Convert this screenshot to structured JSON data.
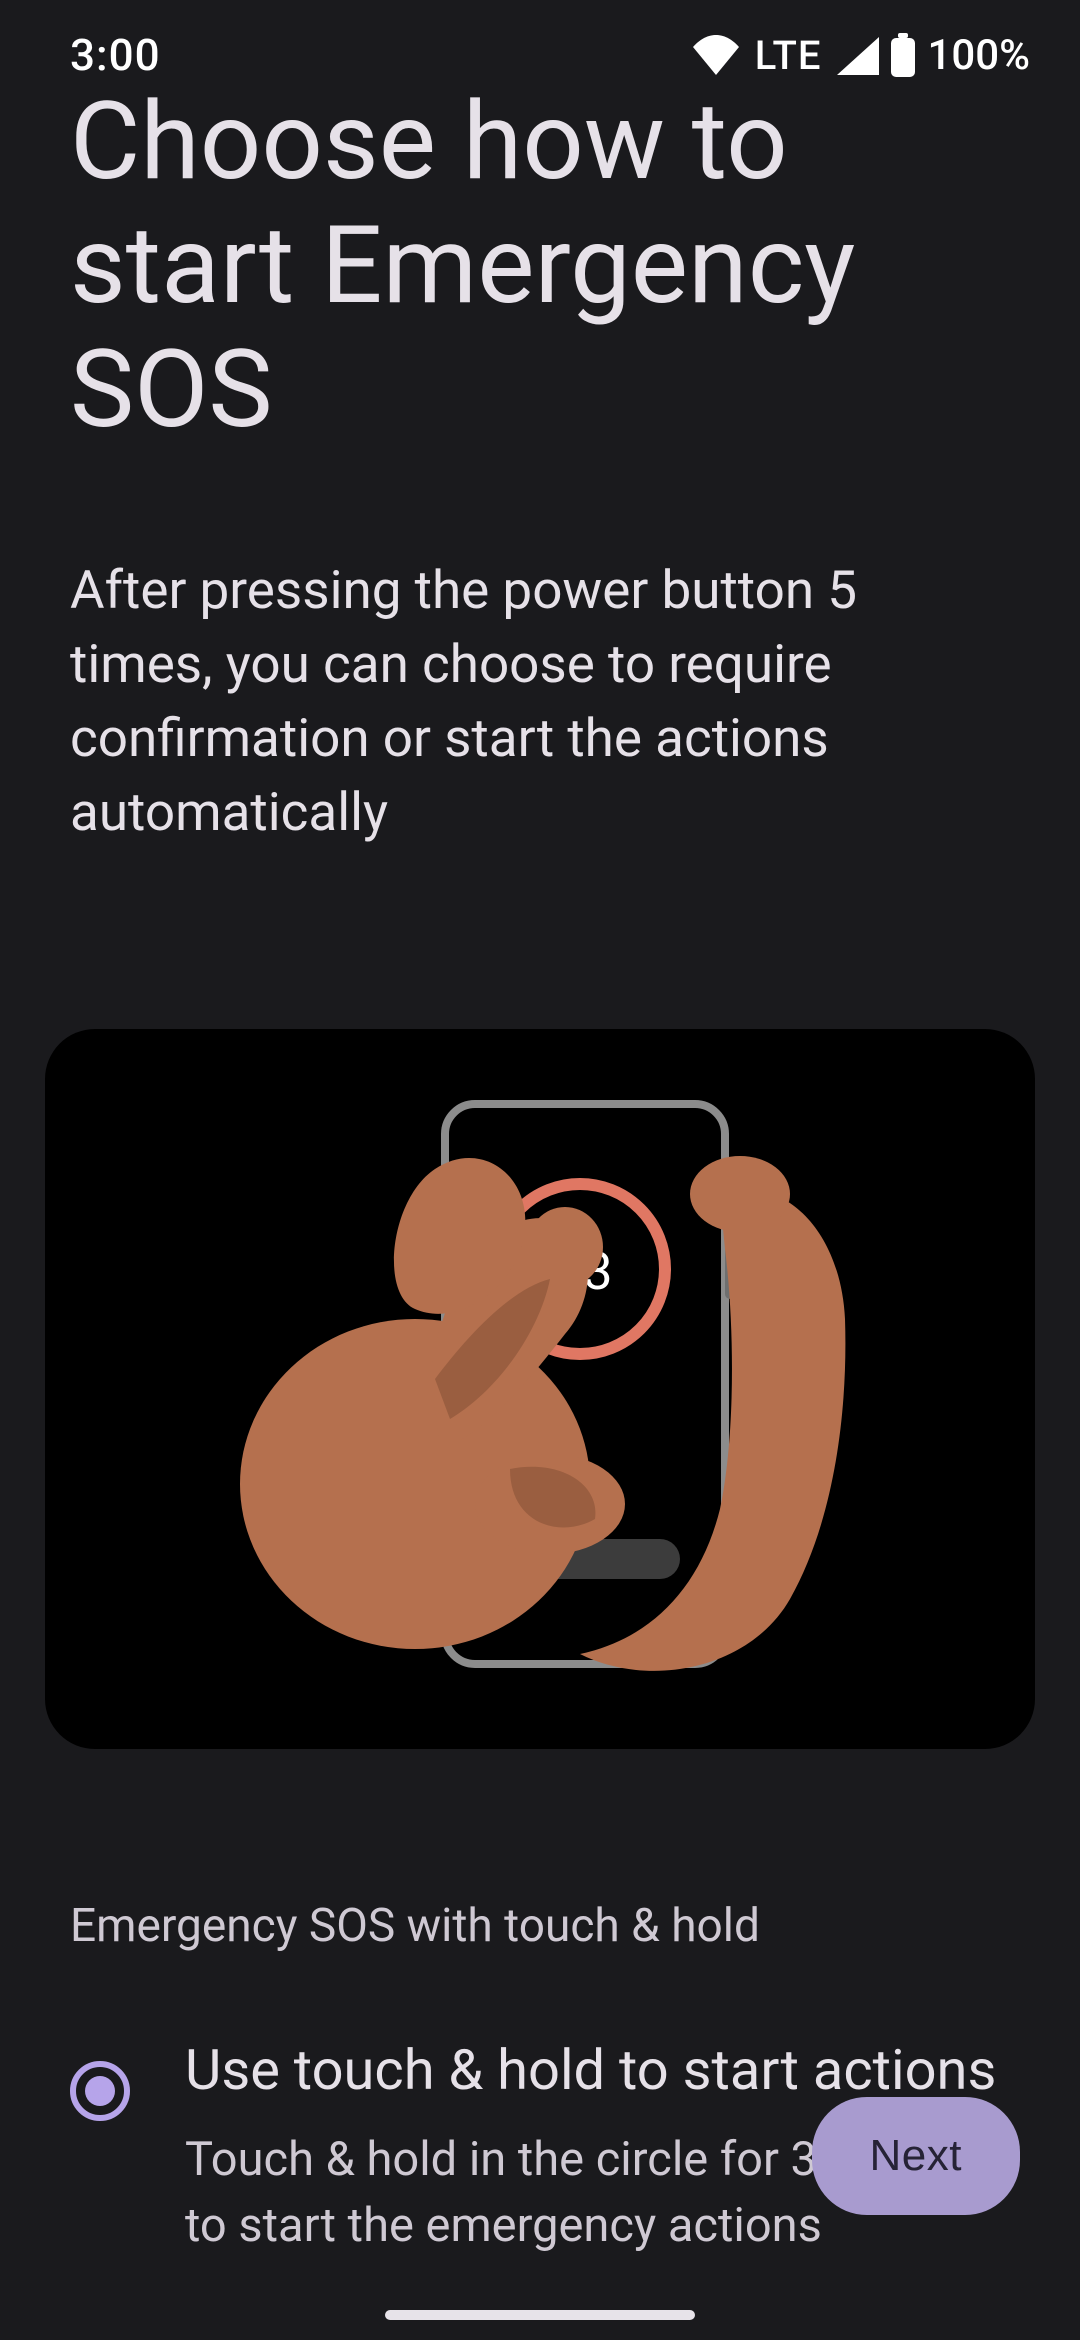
{
  "status": {
    "time": "3:00",
    "lte": "LTE",
    "battery_pct": "100%"
  },
  "header": {
    "title": "Choose how to start Emergency SOS",
    "subtitle": "After pressing the power button 5 times, you can choose to require confirmation or start the actions automatically"
  },
  "illustration": {
    "countdown": "3"
  },
  "section_label": "Emergency SOS with touch & hold",
  "option": {
    "title": "Use touch & hold to start actions",
    "description": "Touch & hold in the circle for 3 seconds to start the emergency actions",
    "selected": true
  },
  "next_button": "Next",
  "colors": {
    "accent": "#b6a4ea",
    "button_bg": "#a89bcf",
    "countdown_ring": "#e07763"
  }
}
